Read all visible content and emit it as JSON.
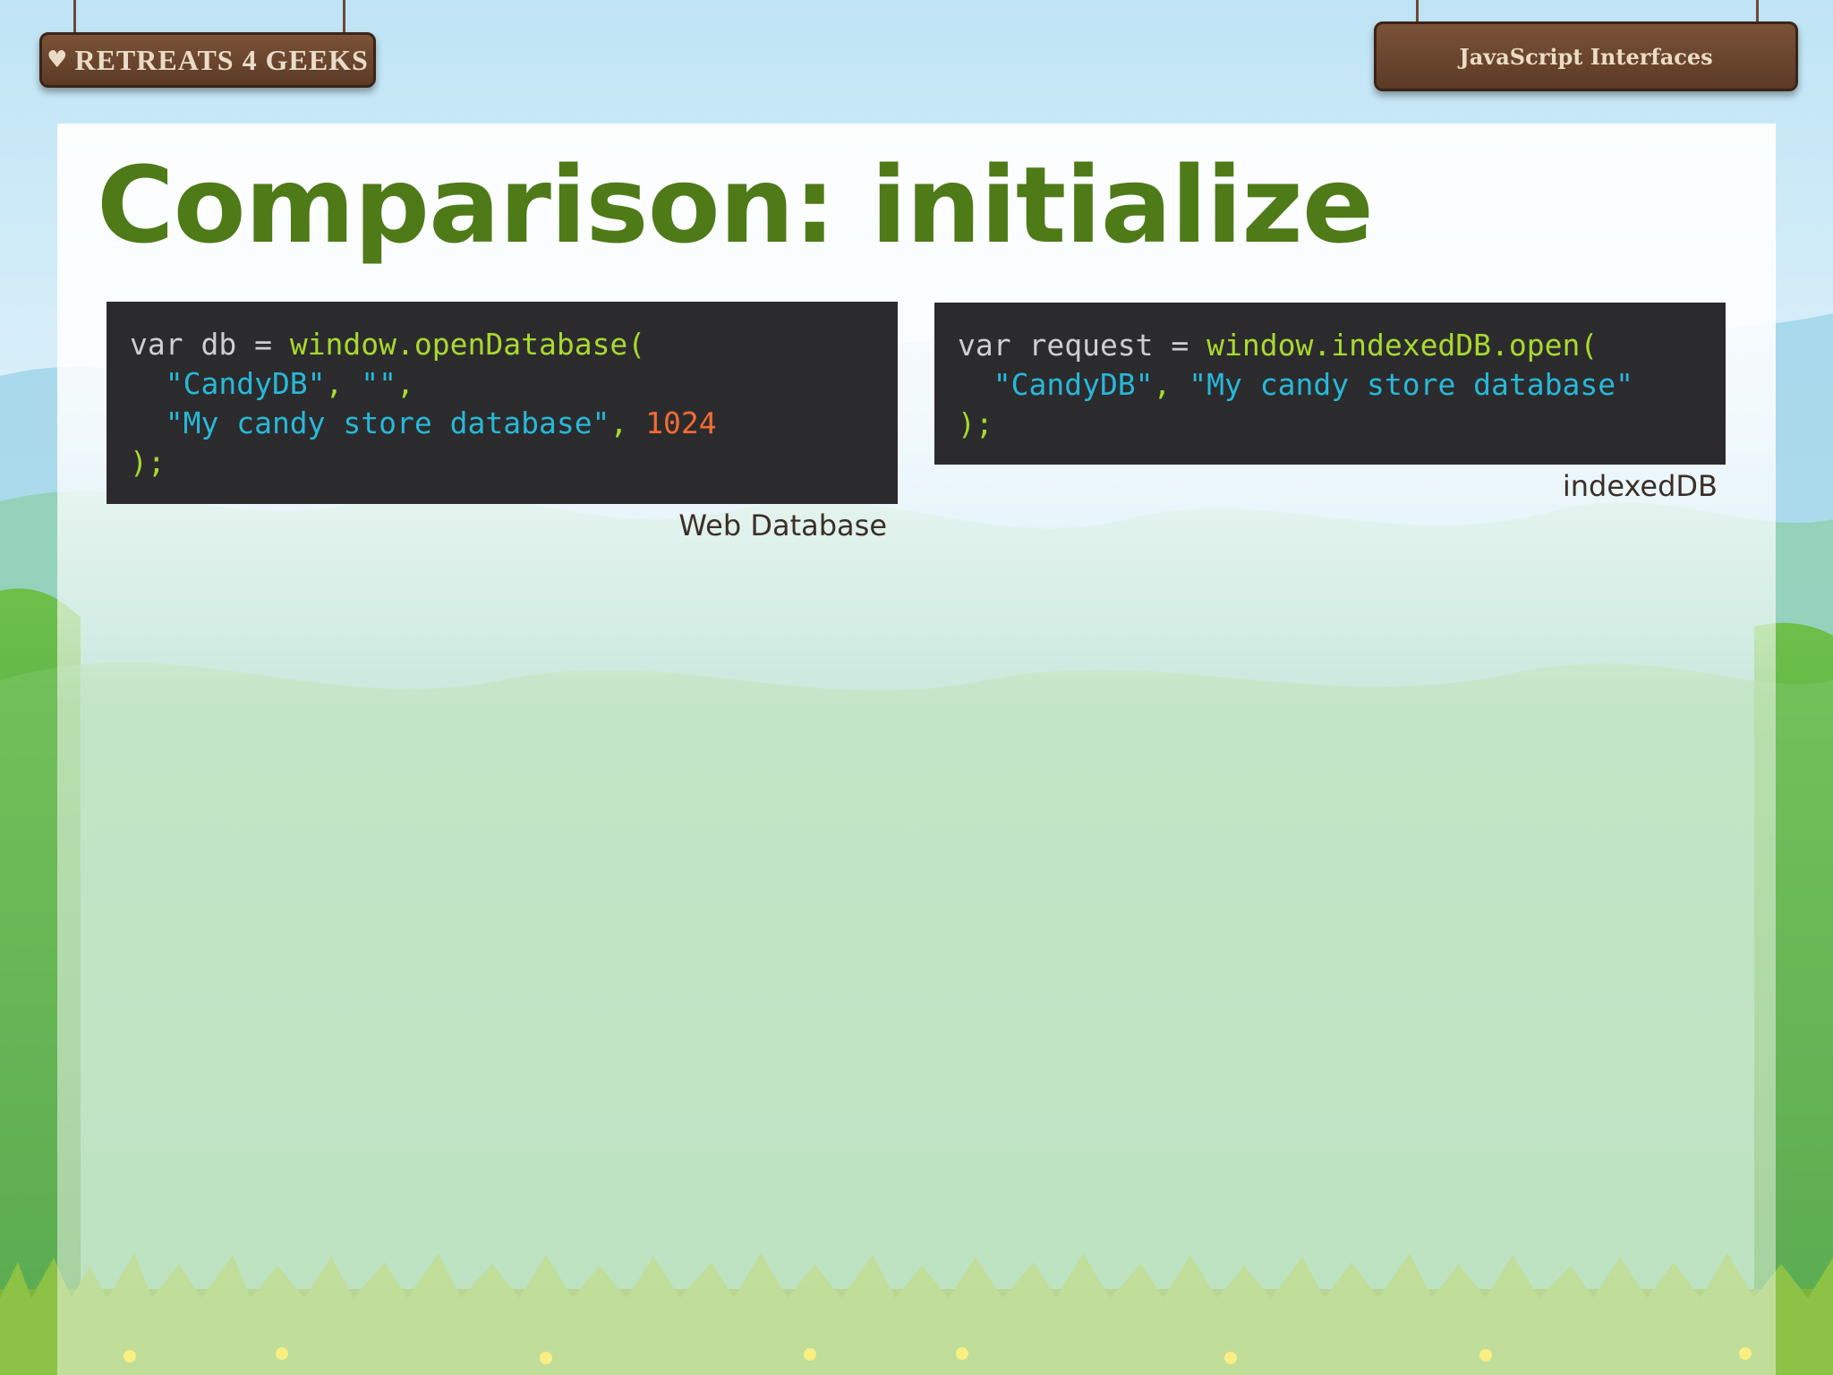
{
  "header": {
    "logo_text": "RETREATS 4 GEEKS",
    "section_label": "JavaScript Interfaces"
  },
  "slide": {
    "title": "Comparison: initialize"
  },
  "examples": [
    {
      "caption": "Web Database",
      "lines": [
        [
          {
            "t": "var db = ",
            "c": "kw"
          },
          {
            "t": "window.openDatabase(",
            "c": "fn"
          }
        ],
        [
          {
            "t": "  \"CandyDB\"",
            "c": "str"
          },
          {
            "t": ", ",
            "c": "punct"
          },
          {
            "t": "\"\"",
            "c": "str"
          },
          {
            "t": ",",
            "c": "punct"
          }
        ],
        [
          {
            "t": "  \"My candy store database\"",
            "c": "str"
          },
          {
            "t": ", ",
            "c": "punct"
          },
          {
            "t": "1024",
            "c": "num"
          }
        ],
        [
          {
            "t": ");",
            "c": "punct"
          }
        ]
      ]
    },
    {
      "caption": "indexedDB",
      "lines": [
        [
          {
            "t": "var request = ",
            "c": "kw"
          },
          {
            "t": "window.indexedDB.open(",
            "c": "fn"
          }
        ],
        [
          {
            "t": "  \"CandyDB\"",
            "c": "str"
          },
          {
            "t": ", ",
            "c": "punct"
          },
          {
            "t": "\"My candy store database\"",
            "c": "str"
          }
        ],
        [
          {
            "t": ");",
            "c": "punct"
          }
        ]
      ]
    }
  ],
  "colors": {
    "title": "#4f7a18",
    "code_bg": "#2b2b2e",
    "keyword": "#cfcfcf",
    "function": "#a8d92e",
    "string": "#27b8d8",
    "number": "#f26b35",
    "sign_wood": "#6b4530"
  },
  "icons": {
    "logo": "heart-icon"
  }
}
